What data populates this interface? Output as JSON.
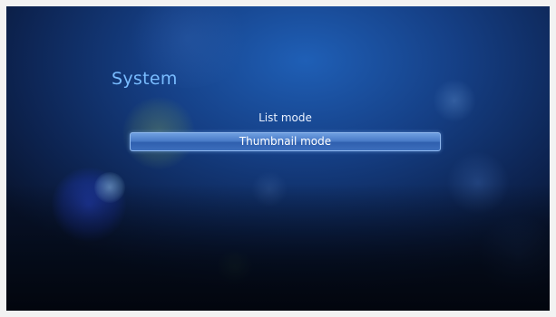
{
  "screen": {
    "title": "System",
    "menu": [
      {
        "label": "List mode",
        "selected": false
      },
      {
        "label": "Thumbnail mode",
        "selected": true
      }
    ]
  },
  "colors": {
    "title": "#79bcff",
    "background": "#153f85",
    "highlight": "#4a7cc8"
  }
}
